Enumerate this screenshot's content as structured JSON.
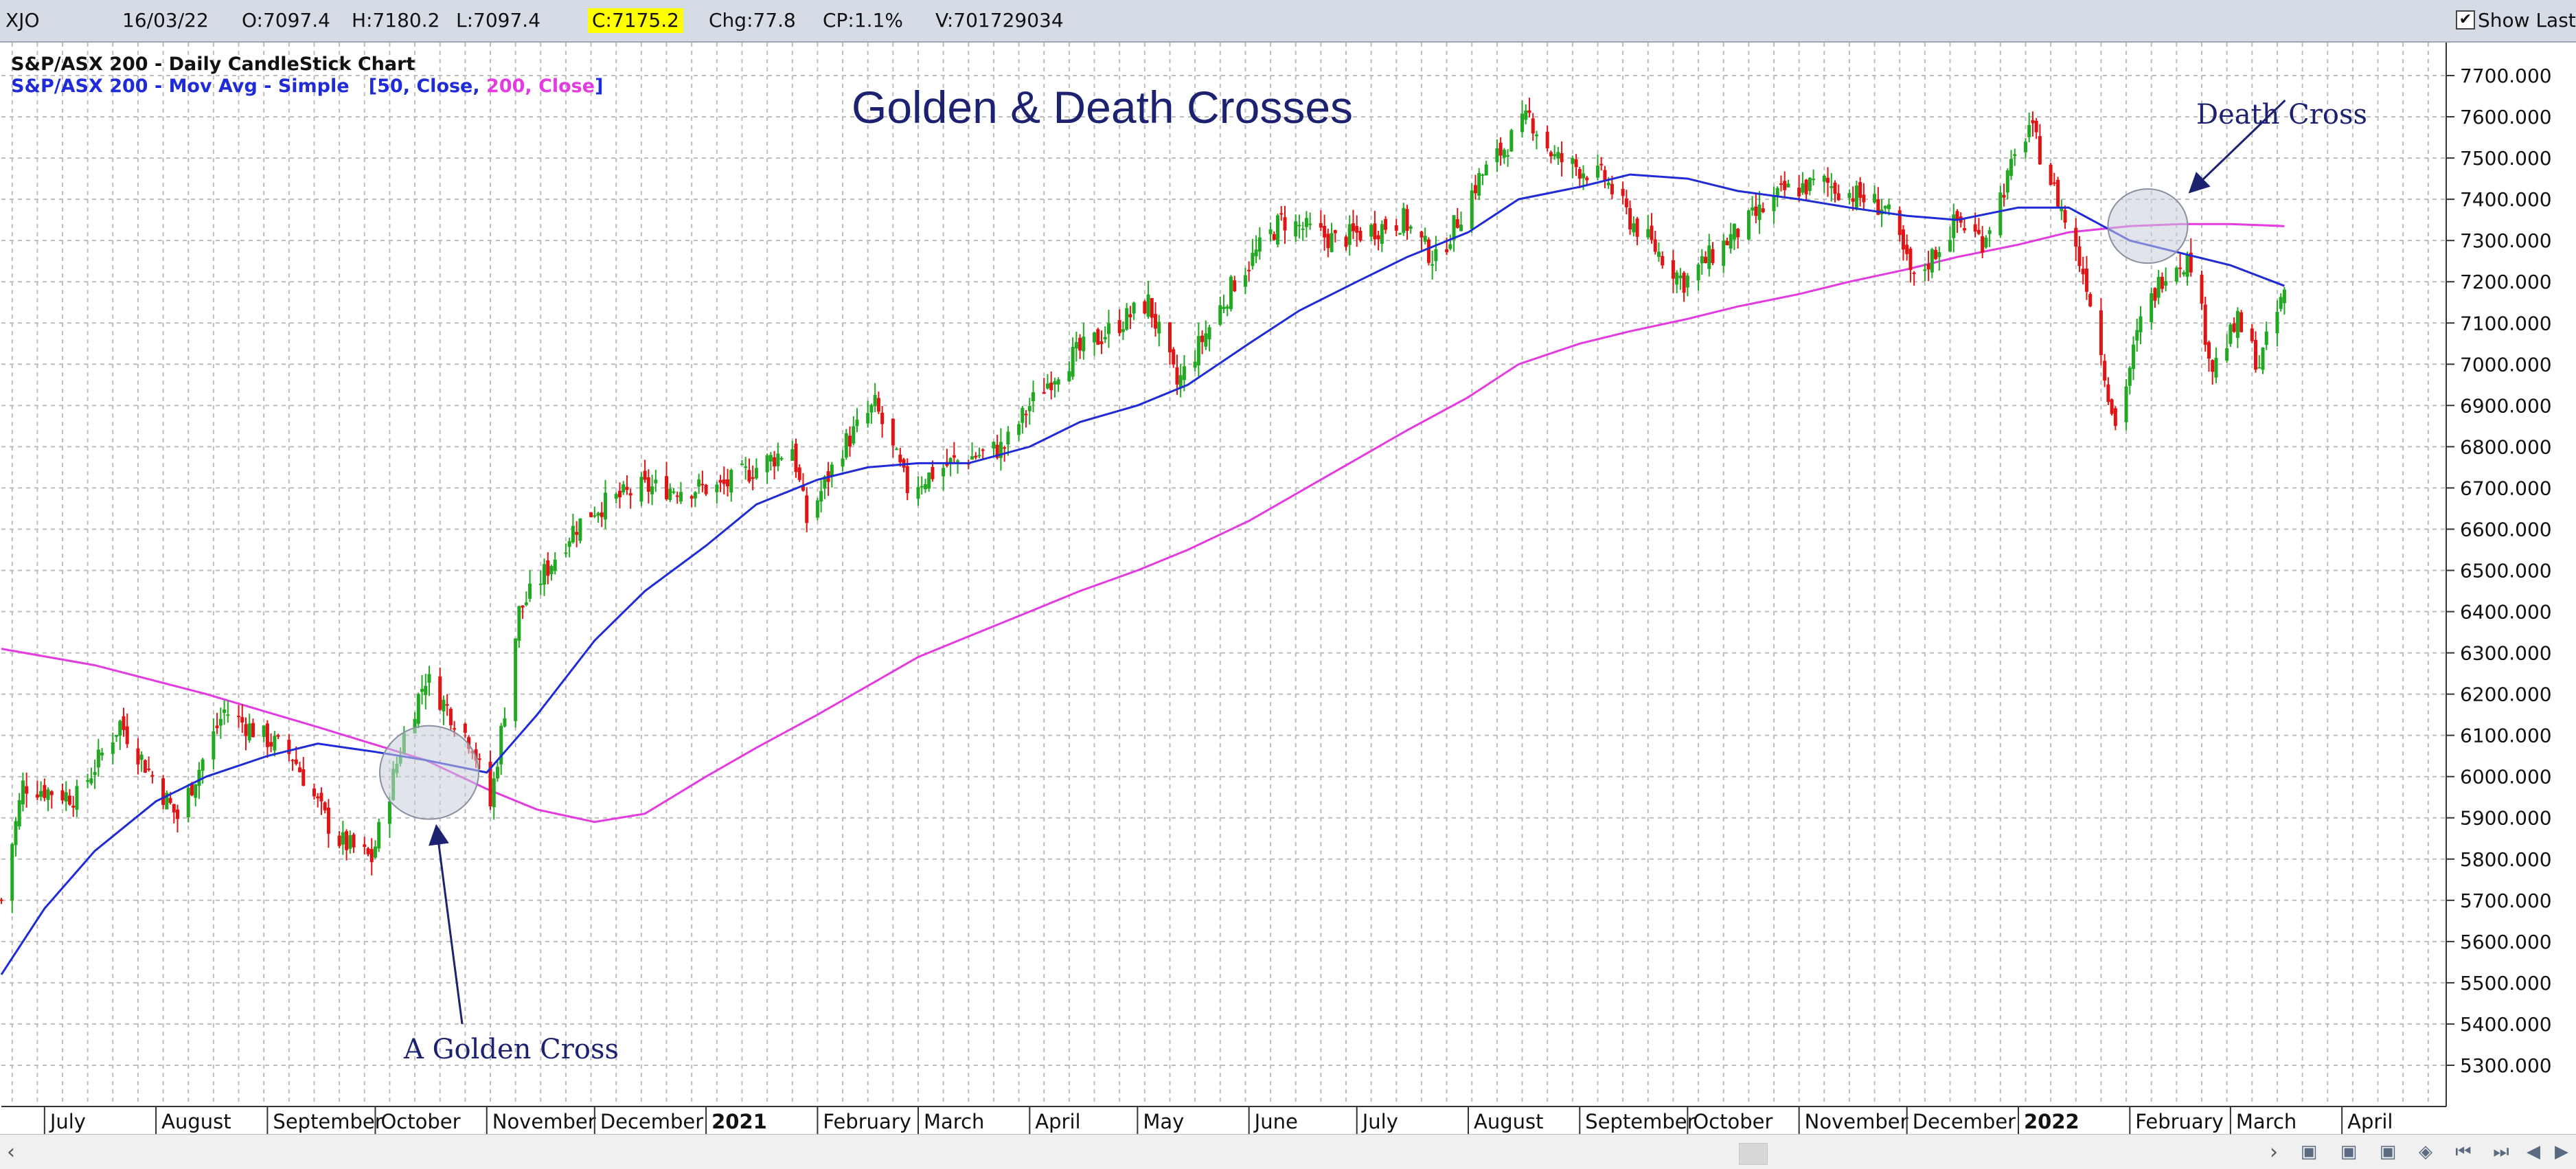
{
  "header": {
    "symbol": "XJO",
    "date": "16/03/22",
    "open": "O:7097.4",
    "high": "H:7180.2",
    "low": "L:7097.4",
    "close": "C:7175.2",
    "change": "Chg:77.8",
    "change_pct": "CP:1.1%",
    "volume": "V:701729034",
    "show_last_label": "Show Last",
    "show_last_checked": true
  },
  "legend": {
    "line1": "S&P/ASX 200 - Daily CandleStick Chart",
    "line2_prefix": "S&P/ASX 200 - Mov Avg - Simple",
    "p_open": "[",
    "p1": "50, Close,",
    "p2": "200, Close",
    "p_close": "]"
  },
  "annotations": {
    "golden_cross": "A Golden Cross",
    "death_cross": "Death Cross"
  },
  "scrollbar": {
    "left_arrow": "‹",
    "right_arrow": "›",
    "nav_icons": [
      "chart-icon-1",
      "chart-icon-2",
      "chart-icon-3",
      "zoom-icon",
      "first-icon",
      "last-icon",
      "prev-icon",
      "next-icon"
    ]
  },
  "colors": {
    "up": "#22a822",
    "down": "#e01414",
    "ma50": "#1f2bd6",
    "ma200": "#e33be0",
    "grid": "#bdbdbd",
    "circle": "#c8cdd8",
    "arrow": "#1c2270",
    "highlight": "#ffff00"
  },
  "chart_data": {
    "type": "candlestick",
    "title": "Golden & Death Crosses",
    "ylim": [
      5200,
      7780
    ],
    "yticks": [
      5300,
      5400,
      5500,
      5600,
      5700,
      5800,
      5900,
      6000,
      6100,
      6200,
      6300,
      6400,
      6500,
      6600,
      6700,
      6800,
      6900,
      7000,
      7100,
      7200,
      7300,
      7400,
      7500,
      7600,
      7700
    ],
    "ytick_labels": [
      "5300.000",
      "5400.000",
      "5500.000",
      "5600.000",
      "5700.000",
      "5800.000",
      "5900.000",
      "6000.000",
      "6100.000",
      "6200.000",
      "6300.000",
      "6400.000",
      "6500.000",
      "6600.000",
      "6700.000",
      "6800.000",
      "6900.000",
      "7000.000",
      "7100.000",
      "7200.000",
      "7300.000",
      "7400.000",
      "7500.000",
      "7600.000",
      "7700.000"
    ],
    "x_range": [
      "2020-06-19",
      "2022-04-30"
    ],
    "x_labels": [
      {
        "date": "2020-07-01",
        "label": "July",
        "bold": false
      },
      {
        "date": "2020-08-01",
        "label": "August",
        "bold": false
      },
      {
        "date": "2020-09-01",
        "label": "September",
        "bold": false
      },
      {
        "date": "2020-10-01",
        "label": "October",
        "bold": false
      },
      {
        "date": "2020-11-01",
        "label": "November",
        "bold": false
      },
      {
        "date": "2020-12-01",
        "label": "December",
        "bold": false
      },
      {
        "date": "2021-01-01",
        "label": "2021",
        "bold": true
      },
      {
        "date": "2021-02-01",
        "label": "February",
        "bold": false
      },
      {
        "date": "2021-03-01",
        "label": "March",
        "bold": false
      },
      {
        "date": "2021-04-01",
        "label": "April",
        "bold": false
      },
      {
        "date": "2021-05-01",
        "label": "May",
        "bold": false
      },
      {
        "date": "2021-06-01",
        "label": "June",
        "bold": false
      },
      {
        "date": "2021-07-01",
        "label": "July",
        "bold": false
      },
      {
        "date": "2021-08-01",
        "label": "August",
        "bold": false
      },
      {
        "date": "2021-09-01",
        "label": "September",
        "bold": false
      },
      {
        "date": "2021-10-01",
        "label": "October",
        "bold": false
      },
      {
        "date": "2021-11-01",
        "label": "November",
        "bold": false
      },
      {
        "date": "2021-12-01",
        "label": "December",
        "bold": false
      },
      {
        "date": "2022-01-01",
        "label": "2022",
        "bold": true
      },
      {
        "date": "2022-02-01",
        "label": "February",
        "bold": false
      },
      {
        "date": "2022-03-01",
        "label": "March",
        "bold": false
      },
      {
        "date": "2022-04-01",
        "label": "April",
        "bold": false
      }
    ],
    "price_path": [
      [
        "2020-06-19",
        5700
      ],
      [
        "2020-06-25",
        5980
      ],
      [
        "2020-07-10",
        5950
      ],
      [
        "2020-07-22",
        6130
      ],
      [
        "2020-08-07",
        5900
      ],
      [
        "2020-08-20",
        6160
      ],
      [
        "2020-09-08",
        6050
      ],
      [
        "2020-09-20",
        5850
      ],
      [
        "2020-09-30",
        5800
      ],
      [
        "2020-10-09",
        6100
      ],
      [
        "2020-10-15",
        6240
      ],
      [
        "2020-10-28",
        6080
      ],
      [
        "2020-11-02",
        5930
      ],
      [
        "2020-11-10",
        6400
      ],
      [
        "2020-11-25",
        6600
      ],
      [
        "2020-12-01",
        6650
      ],
      [
        "2020-12-14",
        6700
      ],
      [
        "2021-01-05",
        6700
      ],
      [
        "2021-01-25",
        6800
      ],
      [
        "2021-01-29",
        6620
      ],
      [
        "2021-02-08",
        6800
      ],
      [
        "2021-02-17",
        6900
      ],
      [
        "2021-02-26",
        6700
      ],
      [
        "2021-03-10",
        6760
      ],
      [
        "2021-03-25",
        6800
      ],
      [
        "2021-04-01",
        6900
      ],
      [
        "2021-04-10",
        7000
      ],
      [
        "2021-05-04",
        7150
      ],
      [
        "2021-05-12",
        6950
      ],
      [
        "2021-05-28",
        7200
      ],
      [
        "2021-06-10",
        7350
      ],
      [
        "2021-06-25",
        7300
      ],
      [
        "2021-07-14",
        7350
      ],
      [
        "2021-07-23",
        7250
      ],
      [
        "2021-08-04",
        7450
      ],
      [
        "2021-08-18",
        7600
      ],
      [
        "2021-08-25",
        7500
      ],
      [
        "2021-09-08",
        7450
      ],
      [
        "2021-09-15",
        7350
      ],
      [
        "2021-09-30",
        7200
      ],
      [
        "2021-10-12",
        7300
      ],
      [
        "2021-10-28",
        7420
      ],
      [
        "2021-11-08",
        7440
      ],
      [
        "2021-11-25",
        7380
      ],
      [
        "2021-12-03",
        7200
      ],
      [
        "2021-12-15",
        7350
      ],
      [
        "2021-12-22",
        7300
      ],
      [
        "2022-01-04",
        7580
      ],
      [
        "2022-01-12",
        7400
      ],
      [
        "2022-01-20",
        7200
      ],
      [
        "2022-01-28",
        6850
      ],
      [
        "2022-02-04",
        7100
      ],
      [
        "2022-02-12",
        7250
      ],
      [
        "2022-02-18",
        7250
      ],
      [
        "2022-02-24",
        6990
      ],
      [
        "2022-03-03",
        7100
      ],
      [
        "2022-03-09",
        7000
      ],
      [
        "2022-03-16",
        7175
      ]
    ],
    "series": [
      {
        "name": "50, Close",
        "color": "#1f2bd6",
        "points": [
          [
            "2020-06-19",
            5520
          ],
          [
            "2020-07-01",
            5680
          ],
          [
            "2020-07-15",
            5820
          ],
          [
            "2020-08-01",
            5940
          ],
          [
            "2020-08-15",
            6000
          ],
          [
            "2020-09-01",
            6050
          ],
          [
            "2020-09-15",
            6080
          ],
          [
            "2020-10-01",
            6060
          ],
          [
            "2020-10-15",
            6040
          ],
          [
            "2020-11-01",
            6010
          ],
          [
            "2020-11-15",
            6150
          ],
          [
            "2020-12-01",
            6330
          ],
          [
            "2020-12-15",
            6450
          ],
          [
            "2021-01-01",
            6560
          ],
          [
            "2021-01-15",
            6660
          ],
          [
            "2021-02-01",
            6720
          ],
          [
            "2021-02-15",
            6750
          ],
          [
            "2021-03-01",
            6760
          ],
          [
            "2021-03-15",
            6760
          ],
          [
            "2021-04-01",
            6800
          ],
          [
            "2021-04-15",
            6860
          ],
          [
            "2021-05-01",
            6900
          ],
          [
            "2021-05-15",
            6950
          ],
          [
            "2021-06-01",
            7050
          ],
          [
            "2021-06-15",
            7130
          ],
          [
            "2021-07-01",
            7200
          ],
          [
            "2021-07-15",
            7260
          ],
          [
            "2021-08-01",
            7320
          ],
          [
            "2021-08-15",
            7400
          ],
          [
            "2021-09-01",
            7430
          ],
          [
            "2021-09-15",
            7460
          ],
          [
            "2021-10-01",
            7450
          ],
          [
            "2021-10-15",
            7420
          ],
          [
            "2021-11-01",
            7400
          ],
          [
            "2021-11-15",
            7380
          ],
          [
            "2021-12-01",
            7360
          ],
          [
            "2021-12-15",
            7350
          ],
          [
            "2022-01-01",
            7380
          ],
          [
            "2022-01-15",
            7380
          ],
          [
            "2022-02-01",
            7300
          ],
          [
            "2022-02-15",
            7270
          ],
          [
            "2022-03-01",
            7240
          ],
          [
            "2022-03-16",
            7190
          ]
        ]
      },
      {
        "name": "200, Close",
        "color": "#e33be0",
        "points": [
          [
            "2020-06-19",
            6310
          ],
          [
            "2020-07-15",
            6270
          ],
          [
            "2020-08-15",
            6200
          ],
          [
            "2020-09-15",
            6120
          ],
          [
            "2020-10-15",
            6040
          ],
          [
            "2020-11-01",
            5970
          ],
          [
            "2020-11-15",
            5920
          ],
          [
            "2020-12-01",
            5890
          ],
          [
            "2020-12-15",
            5910
          ],
          [
            "2021-01-01",
            6000
          ],
          [
            "2021-01-15",
            6070
          ],
          [
            "2021-02-01",
            6150
          ],
          [
            "2021-02-15",
            6220
          ],
          [
            "2021-03-01",
            6290
          ],
          [
            "2021-03-15",
            6340
          ],
          [
            "2021-04-01",
            6400
          ],
          [
            "2021-04-15",
            6450
          ],
          [
            "2021-05-01",
            6500
          ],
          [
            "2021-05-15",
            6550
          ],
          [
            "2021-06-01",
            6620
          ],
          [
            "2021-06-15",
            6690
          ],
          [
            "2021-07-01",
            6770
          ],
          [
            "2021-07-15",
            6840
          ],
          [
            "2021-08-01",
            6920
          ],
          [
            "2021-08-15",
            7000
          ],
          [
            "2021-09-01",
            7050
          ],
          [
            "2021-09-15",
            7080
          ],
          [
            "2021-10-01",
            7110
          ],
          [
            "2021-10-15",
            7140
          ],
          [
            "2021-11-01",
            7170
          ],
          [
            "2021-11-15",
            7200
          ],
          [
            "2021-12-01",
            7230
          ],
          [
            "2021-12-15",
            7260
          ],
          [
            "2022-01-01",
            7290
          ],
          [
            "2022-01-15",
            7320
          ],
          [
            "2022-02-01",
            7335
          ],
          [
            "2022-02-15",
            7340
          ],
          [
            "2022-03-01",
            7340
          ],
          [
            "2022-03-16",
            7335
          ]
        ]
      }
    ],
    "annotations": [
      {
        "label": "A Golden Cross",
        "date": "2020-10-16",
        "value": 6010
      },
      {
        "label": "Death Cross",
        "date": "2022-02-06",
        "value": 7335
      }
    ],
    "grid": true,
    "ylabel": "",
    "xlabel": ""
  }
}
